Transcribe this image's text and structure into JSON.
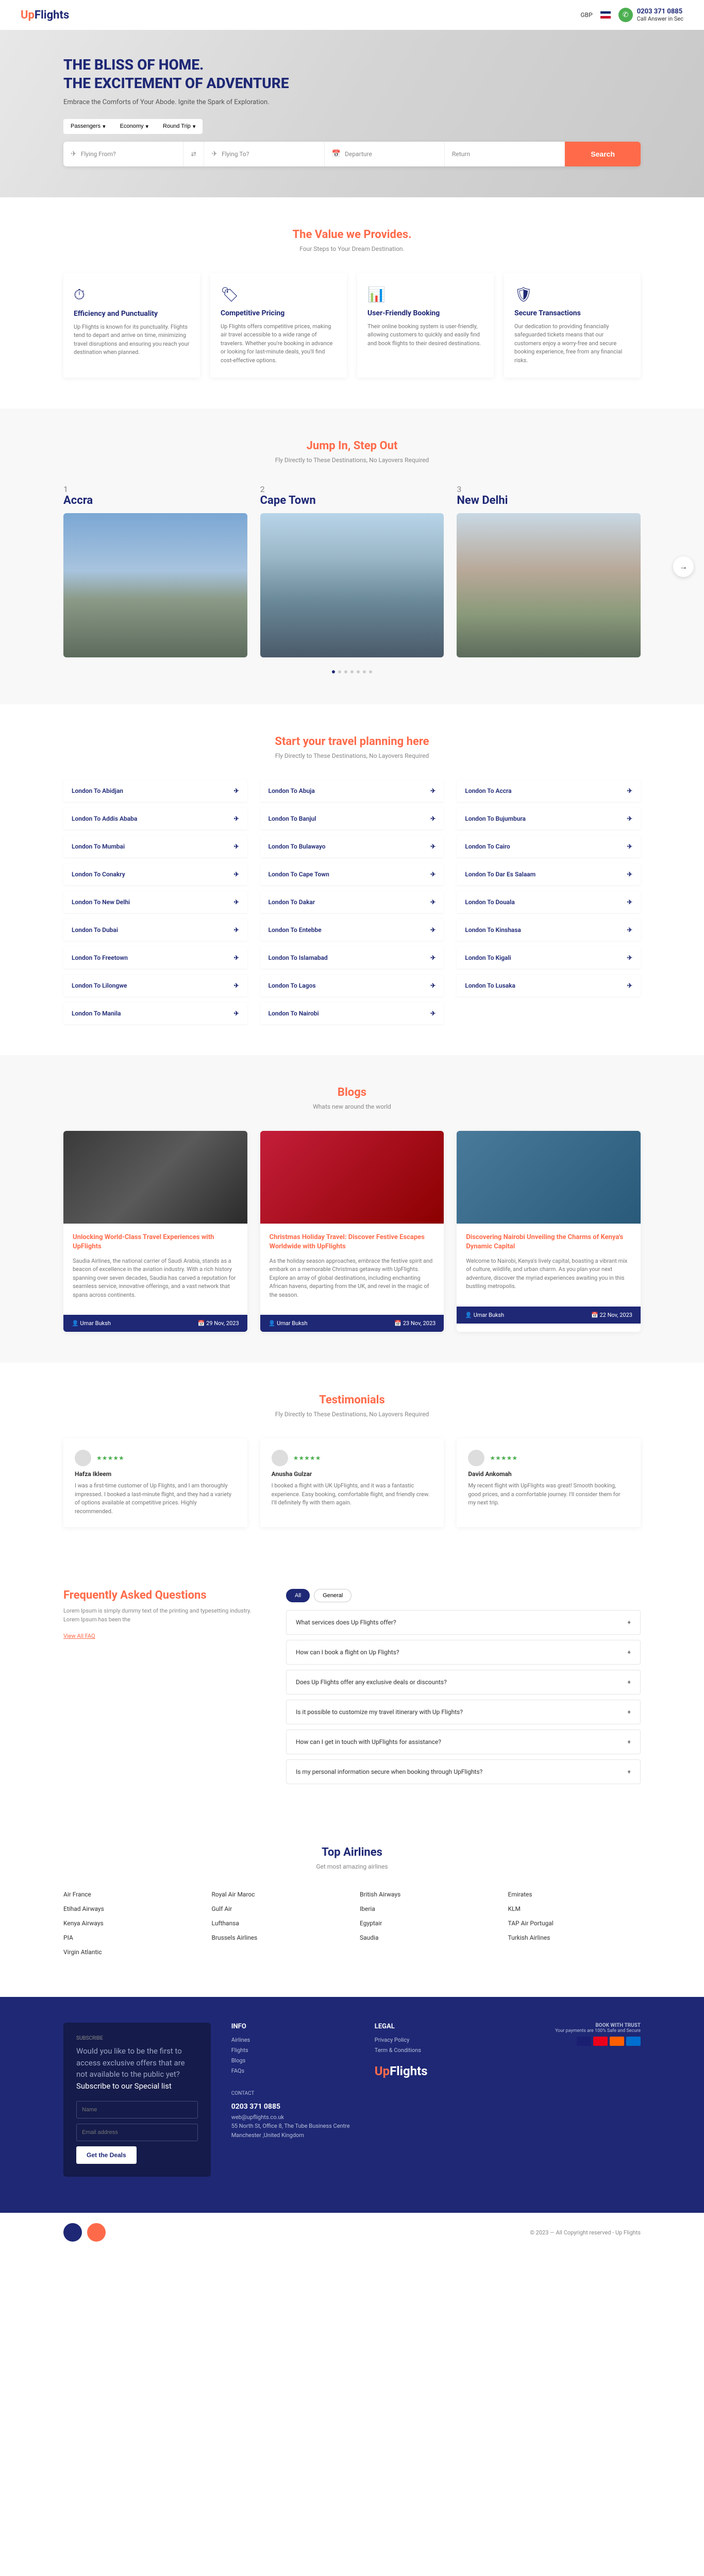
{
  "header": {
    "logo_up": "Up",
    "logo_flights": "Flights",
    "currency": "GBP",
    "phone": "0203 371 0885",
    "phone_sub": "Call Answer in Sec"
  },
  "hero": {
    "title1": "THE BLISS OF HOME.",
    "title2": "THE EXCITEMENT OF ADVENTURE",
    "sub": "Embrace the Comforts of Your Abode. Ignite the Spark of Exploration.",
    "tabs": [
      "Passengers",
      "Economy",
      "Round Trip"
    ],
    "fields": {
      "from": "Flying From?",
      "to": "Flying To?",
      "depart": "Departure",
      "return": "Return"
    },
    "search": "Search"
  },
  "value": {
    "title": "The Value we Provides.",
    "sub": "Four Steps to Your Dream Destination.",
    "cards": [
      {
        "title": "Efficiency and Punctuality",
        "desc": "Up Flights is known for its punctuality. Flights tend to depart and arrive on time, minimizing travel disruptions and ensuring you reach your destination when planned."
      },
      {
        "title": "Competitive Pricing",
        "desc": "Up Flights offers competitive prices, making air travel accessible to a wide range of travelers. Whether you're booking in advance or looking for last-minute deals, you'll find cost-effective options."
      },
      {
        "title": "User-Friendly Booking",
        "desc": "Their online booking system is user-friendly, allowing customers to quickly and easily find and book flights to their desired destinations."
      },
      {
        "title": "Secure Transactions",
        "desc": "Our dedication to providing financially safeguarded tickets means that our customers enjoy a worry-free and secure booking experience, free from any financial risks."
      }
    ]
  },
  "dest": {
    "title": "Jump In, Step Out",
    "sub": "Fly Directly to These Destinations, No Layovers Required",
    "items": [
      {
        "num": "1",
        "name": "Accra"
      },
      {
        "num": "2",
        "name": "Cape Town"
      },
      {
        "num": "3",
        "name": "New Delhi"
      }
    ]
  },
  "routes": {
    "title": "Start your travel planning here",
    "sub": "Fly Directly to These Destinations, No Layovers Required",
    "items": [
      "London To Abidjan",
      "London To Abuja",
      "London To Accra",
      "London To Addis Ababa",
      "London To Banjul",
      "London To Bujumbura",
      "London To Mumbai",
      "London To Bulawayo",
      "London To Cairo",
      "London To Conakry",
      "London To Cape Town",
      "London To Dar Es Salaam",
      "London To New Delhi",
      "London To Dakar",
      "London To Douala",
      "London To Dubai",
      "London To Entebbe",
      "London To Kinshasa",
      "London To Freetown",
      "London To Islamabad",
      "London To Kigali",
      "London To Lilongwe",
      "London To Lagos",
      "London To Lusaka",
      "London To Manila",
      "London To Nairobi"
    ]
  },
  "blogs": {
    "title": "Blogs",
    "sub": "Whats new around the world",
    "items": [
      {
        "title": "Unlocking World-Class Travel Experiences with UpFlights",
        "excerpt": "Saudia Airlines, the national carrier of Saudi Arabia, stands as a beacon of excellence in the aviation industry. With a rich history spanning over seven decades, Saudia has carved a reputation for seamless service, innovative offerings, and a vast network that spans across continents.",
        "author": "Umar Buksh",
        "date": "29 Nov, 2023"
      },
      {
        "title": "Christmas Holiday Travel: Discover Festive Escapes Worldwide with UpFlights",
        "excerpt": "As the holiday season approaches, embrace the festive spirit and embark on a memorable Christmas getaway with UpFlights. Explore an array of global destinations, including enchanting African havens, departing from the UK, and revel in the magic of the season.",
        "author": "Umar Buksh",
        "date": "23 Nov, 2023"
      },
      {
        "title": "Discovering Nairobi Unveiling the Charms of Kenya's Dynamic Capital",
        "excerpt": "Welcome to Nairobi, Kenya's lively capital, boasting a vibrant mix of culture, wildlife, and urban charm. As you plan your next adventure, discover the myriad experiences awaiting you in this bustling metropolis.",
        "author": "Umar Buksh",
        "date": "22 Nov, 2023"
      }
    ]
  },
  "testimonials": {
    "title": "Testimonials",
    "sub": "Fly Directly to These Destinations, No Layovers Required",
    "items": [
      {
        "name": "Hafza Ikleem",
        "text": "I was a first-time customer of Up Flights, and I am thoroughly impressed. I booked a last-minute flight, and they had a variety of options available at competitive prices. Highly recommended."
      },
      {
        "name": "Anusha Gulzar",
        "text": "I booked a flight with UK UpFlights, and it was a fantastic experience. Easy booking, comfortable flight, and friendly crew. I'll definitely fly with them again."
      },
      {
        "name": "David Ankomah",
        "text": "My recent flight with UpFlights was great! Smooth booking, good prices, and a comfortable journey. I'll consider them for my next trip."
      }
    ]
  },
  "faq": {
    "title": "Frequently Asked Questions",
    "desc": "Lorem Ipsum is simply dummy text of the printing and typesetting industry. Lorem Ipsum has been the",
    "link": "View All FAQ",
    "tabs": [
      "All",
      "General"
    ],
    "items": [
      "What services does Up Flights offer?",
      "How can I book a flight on Up Flights?",
      "Does Up Flights offer any exclusive deals or discounts?",
      "Is it possible to customize my travel itinerary with Up Flights?",
      "How can I get in touch with UpFlights for assistance?",
      "Is my personal information secure when booking through UpFlights?"
    ]
  },
  "airlines": {
    "title": "Top Airlines",
    "sub": "Get most amazing airlines",
    "items": [
      "Air France",
      "Royal Air Maroc",
      "British Airways",
      "Emirates",
      "Etihad Airways",
      "Gulf Air",
      "Iberia",
      "KLM",
      "Kenya Airways",
      "Lufthansa",
      "Egyptair",
      "TAP Air Portugal",
      "PIA",
      "Brussels Airlines",
      "Saudia",
      "Turkish Airlines",
      "Virgin Atlantic"
    ]
  },
  "footer": {
    "sub_label": "SUBSCRIBE",
    "sub_text1": "Would you like to be the first to access exclusive offers that are not available to the public yet? ",
    "sub_text2": "Subscribe to our Special list",
    "name_ph": "Name",
    "email_ph": "Email address",
    "btn": "Get the Deals",
    "info_title": "INFO",
    "info_items": [
      "Airlines",
      "Flights",
      "Blogs",
      "FAQs"
    ],
    "legal_title": "LEGAL",
    "legal_items": [
      "Privacy Policy",
      "Term & Conditions"
    ],
    "contact_label": "CONTACT",
    "phone": "0203 371 0885",
    "email": "web@upflights.co.uk",
    "addr": "55 North St, Office 8, The Tube Business Centre\nManchester ,United Kingdom",
    "trust": "BOOK WITH TRUST",
    "trust2": "Your payments are 100% Safe and Secure",
    "copyright": "© 2023 — All Copyright reserved - Up Flights"
  }
}
